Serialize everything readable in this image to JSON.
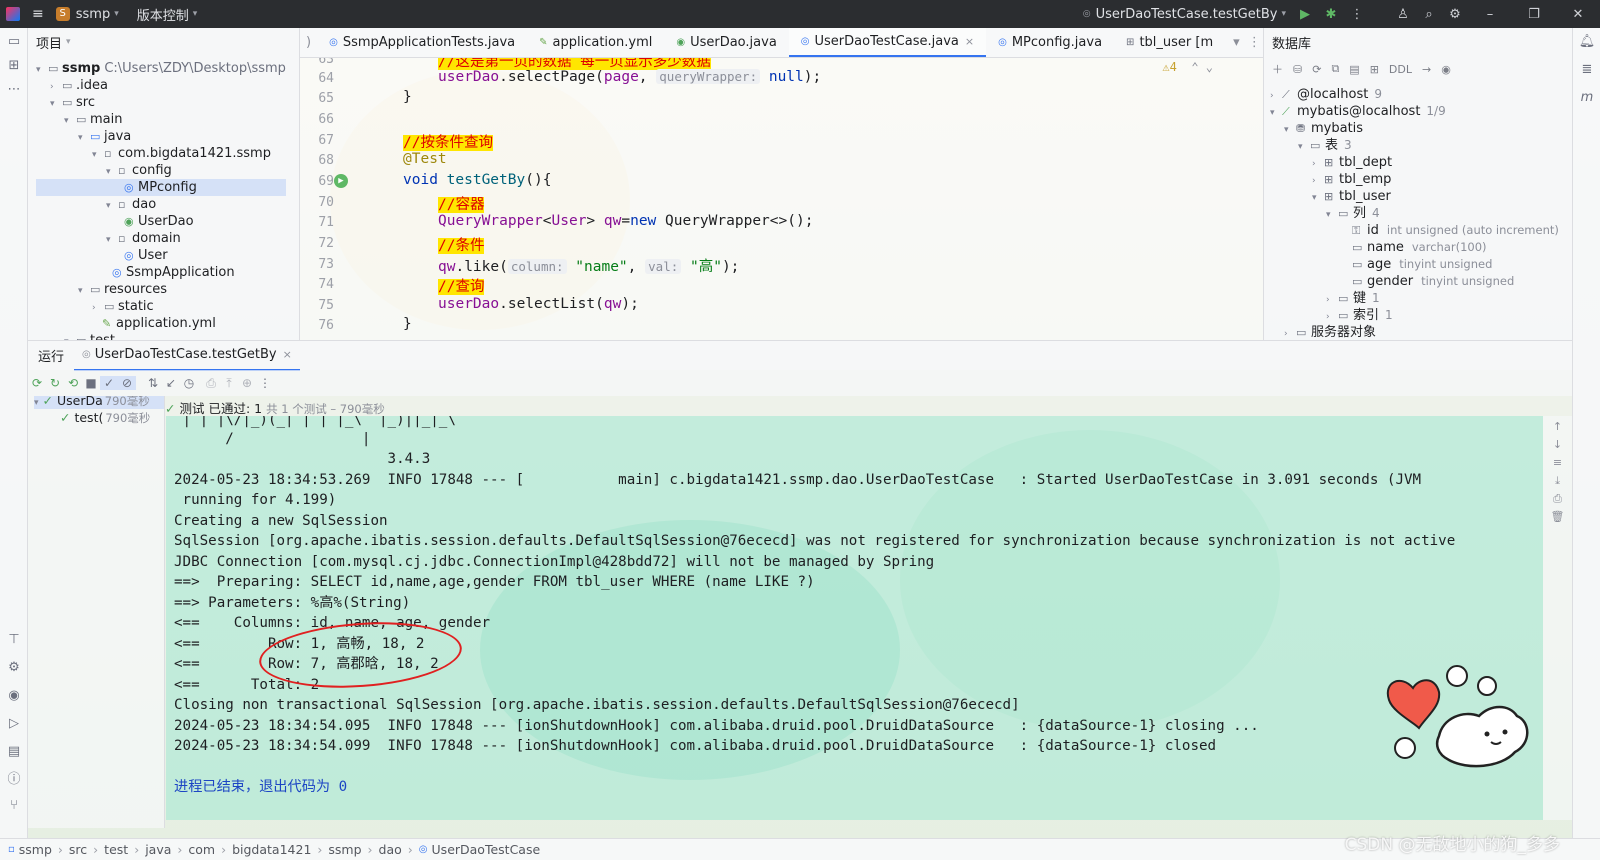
{
  "titlebar": {
    "project": "ssmp",
    "vcs": "版本控制",
    "run_config": "UserDaoTestCase.testGetBy"
  },
  "project_panel": {
    "title": "项目",
    "items": [
      {
        "label": "ssmp",
        "path": "C:\\Users\\ZDY\\Desktop\\ssmp"
      },
      {
        "label": ".idea"
      },
      {
        "label": "src"
      },
      {
        "label": "main"
      },
      {
        "label": "java"
      },
      {
        "label": "com.bigdata1421.ssmp"
      },
      {
        "label": "config"
      },
      {
        "label": "MPconfig"
      },
      {
        "label": "dao"
      },
      {
        "label": "UserDao"
      },
      {
        "label": "domain"
      },
      {
        "label": "User"
      },
      {
        "label": "SsmpApplication"
      },
      {
        "label": "resources"
      },
      {
        "label": "static"
      },
      {
        "label": "application.yml"
      },
      {
        "label": "test"
      }
    ]
  },
  "tabs": [
    {
      "label": "SsmpApplicationTests.java"
    },
    {
      "label": "application.yml"
    },
    {
      "label": "UserDao.java"
    },
    {
      "label": "UserDaoTestCase.java"
    },
    {
      "label": "MPconfig.java"
    },
    {
      "label": "tbl_user [m"
    }
  ],
  "editor": {
    "warning_count": "⚠4",
    "line_numbers": [
      "63",
      "64",
      "65",
      "66",
      "67",
      "68",
      "69",
      "70",
      "71",
      "72",
      "73",
      "74",
      "75",
      "76"
    ],
    "lines": {
      "l63": "//这是第一页的数据 每一页显示多少数据",
      "l64a": "userDao",
      "l64b": ".selectPage(",
      "l64c": "page",
      "l64d": "queryWrapper:",
      "l64e": "null",
      "l64f": ");",
      "l65": "}",
      "l67": "//按条件查询",
      "l68": "@Test",
      "l69a": "void ",
      "l69b": "testGetBy",
      "l69c": "(){",
      "l70": "//容器",
      "l71a": "QueryWrapper",
      "l71b": "<",
      "l71c": "User",
      "l71d": "> ",
      "l71e": "qw",
      "l71f": "=",
      "l71g": "new ",
      "l71h": "QueryWrapper<>();",
      "l72": "//条件",
      "l73a": "qw",
      "l73b": ".like(",
      "l73c": "column:",
      "l73d": "\"name\"",
      "l73e": ", ",
      "l73f": "val:",
      "l73g": "\"高\"",
      "l73h": ");",
      "l74": "//查询",
      "l75a": "userDao",
      "l75b": ".selectList(",
      "l75c": "qw",
      "l75d": ");",
      "l76": "}"
    }
  },
  "database": {
    "title": "数据库",
    "rows": [
      {
        "label": "@localhost",
        "count": "9"
      },
      {
        "label": "mybatis@localhost",
        "count": "1/9"
      },
      {
        "label": "mybatis"
      },
      {
        "label": "表",
        "count": "3"
      },
      {
        "label": "tbl_dept"
      },
      {
        "label": "tbl_emp"
      },
      {
        "label": "tbl_user"
      },
      {
        "label": "列",
        "count": "4"
      },
      {
        "label": "id",
        "type": "int unsigned (auto increment)"
      },
      {
        "label": "name",
        "type": "varchar(100)"
      },
      {
        "label": "age",
        "type": "tinyint unsigned"
      },
      {
        "label": "gender",
        "type": "tinyint unsigned"
      },
      {
        "label": "键",
        "count": "1"
      },
      {
        "label": "索引",
        "count": "1"
      },
      {
        "label": "服务器对象"
      }
    ]
  },
  "run": {
    "label": "运行",
    "tab": "UserDaoTestCase.testGetBy",
    "tree": [
      {
        "label": "UserDa",
        "duration": "790毫秒"
      },
      {
        "label": "test(",
        "duration": "790毫秒"
      }
    ],
    "status_prefix": "测试 已通过: ",
    "status_count": "1",
    "status_suffix": "共 1 个测试 – 790毫秒",
    "console": [
      " | | |\\/|_)(_| | | |_\\  |_)||_|_\\",
      "      /               |",
      "                         3.4.3",
      "2024-05-23 18:34:53.269  INFO 17848 --- [           main] c.bigdata1421.ssmp.dao.UserDaoTestCase   : Started UserDaoTestCase in 3.091 seconds (JVM",
      " running for 4.199)",
      "Creating a new SqlSession",
      "SqlSession [org.apache.ibatis.session.defaults.DefaultSqlSession@76ececd] was not registered for synchronization because synchronization is not active",
      "JDBC Connection [com.mysql.cj.jdbc.ConnectionImpl@428bdd72] will not be managed by Spring",
      "==>  Preparing: SELECT id,name,age,gender FROM tbl_user WHERE (name LIKE ?)",
      "==> Parameters: %高%(String)",
      "<==    Columns: id, name, age, gender",
      "<==        Row: 1, 高畅, 18, 2",
      "<==        Row: 7, 高郡晗, 18, 2",
      "<==      Total: 2",
      "Closing non transactional SqlSession [org.apache.ibatis.session.defaults.DefaultSqlSession@76ececd]",
      "2024-05-23 18:34:54.095  INFO 17848 --- [ionShutdownHook] com.alibaba.druid.pool.DruidDataSource   : {dataSource-1} closing ...",
      "2024-05-23 18:34:54.099  INFO 17848 --- [ionShutdownHook] com.alibaba.druid.pool.DruidDataSource   : {dataSource-1} closed",
      "",
      "进程已结束，退出代码为 0"
    ]
  },
  "statusbar": {
    "crumbs": [
      "ssmp",
      "src",
      "test",
      "java",
      "com",
      "bigdata1421",
      "ssmp",
      "dao",
      "UserDaoTestCase"
    ]
  },
  "watermark": "CSDN @无敌地小的狗_多多",
  "colors": {
    "accent": "#3574f0",
    "run_green": "#5fb865",
    "console_bg": "#a0e8d2",
    "annotation_red": "#e02020"
  }
}
